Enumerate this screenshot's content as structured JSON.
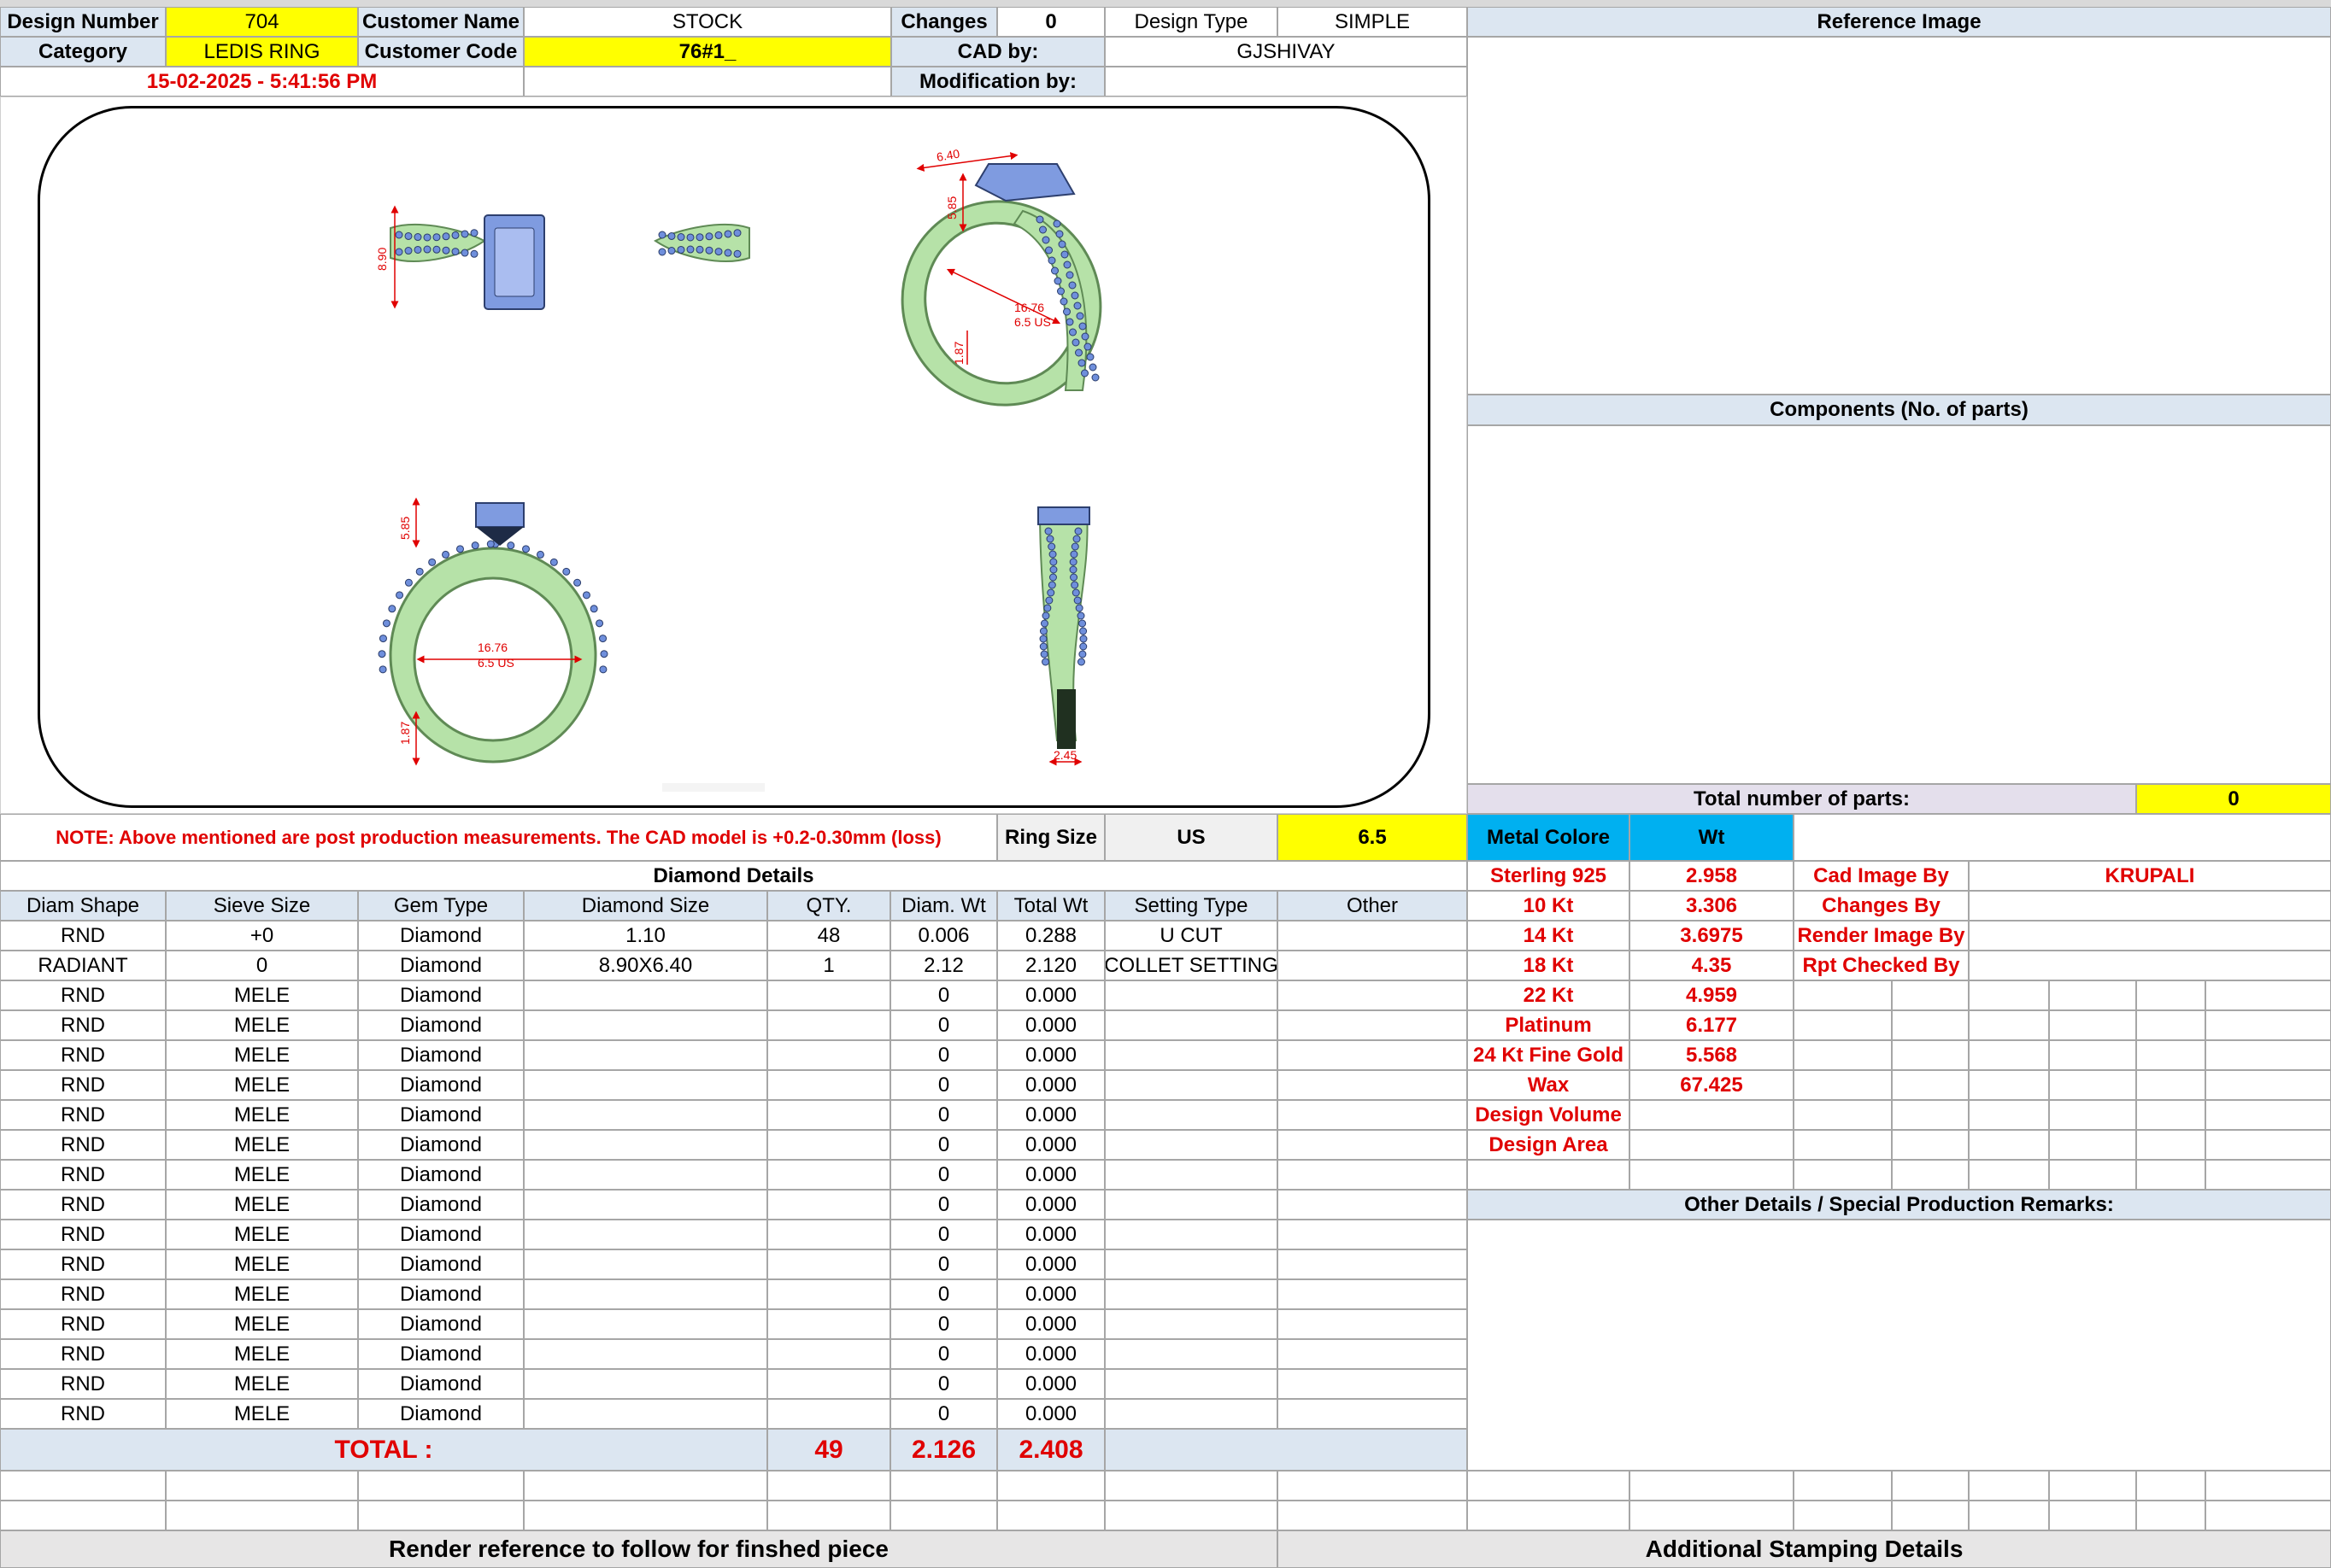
{
  "header": {
    "design_number_label": "Design Number",
    "design_number": "704",
    "customer_name_label": "Customer Name",
    "customer_name": "STOCK",
    "changes_label": "Changes",
    "changes": "0",
    "design_type_label": "Design Type",
    "design_type": "SIMPLE",
    "reference_image_label": "Reference Image",
    "category_label": "Category",
    "category": "LEDIS RING",
    "customer_code_label": "Customer Code",
    "customer_code": "76#1_",
    "cad_by_label": "CAD by:",
    "cad_by": "GJSHIVAY",
    "timestamp": "15-02-2025 - 5:41:56 PM",
    "modification_by_label": "Modification by:"
  },
  "drawing": {
    "top_width": "8.90",
    "persp_w": "6.40",
    "persp_h": "5.85",
    "persp_size": "16.76",
    "persp_us": "6.5 US",
    "persp_shank": "1.87",
    "front_h": "5.85",
    "front_size": "16.76",
    "front_us": "6.5 US",
    "front_shank": "1.87",
    "side_w": "2.45",
    "metal_color": "#b6e2a8",
    "metal_dark": "#5f8a55",
    "stone_color": "#7f9be0",
    "dimension_color": "#e00000"
  },
  "components": {
    "label": "Components (No. of parts)",
    "total_parts_label": "Total number of parts:",
    "total_parts": "0"
  },
  "note": {
    "text": "NOTE: Above mentioned are post production measurements. The CAD model is +0.2-0.30mm (loss)",
    "ring_size_label": "Ring Size",
    "ring_size_unit": "US",
    "ring_size": "6.5"
  },
  "metal": {
    "color_label": "Metal Colore",
    "wt_label": "Wt",
    "rows": [
      {
        "name": "Sterling 925",
        "wt": "2.958"
      },
      {
        "name": "10 Kt",
        "wt": "3.306"
      },
      {
        "name": "14 Kt",
        "wt": "3.6975"
      },
      {
        "name": "18 Kt",
        "wt": "4.35"
      },
      {
        "name": "22 Kt",
        "wt": "4.959"
      },
      {
        "name": "Platinum",
        "wt": "6.177"
      },
      {
        "name": "24 Kt Fine Gold",
        "wt": "5.568"
      },
      {
        "name": "Wax",
        "wt": "67.425"
      },
      {
        "name": "Design Volume",
        "wt": ""
      },
      {
        "name": "Design Area",
        "wt": ""
      }
    ]
  },
  "credits": {
    "rows": [
      {
        "label": "Cad Image By",
        "value": "KRUPALI"
      },
      {
        "label": "Changes By",
        "value": ""
      },
      {
        "label": "Render Image By",
        "value": ""
      },
      {
        "label": "Rpt Checked By",
        "value": ""
      }
    ]
  },
  "remarks_label": "Other Details / Special Production Remarks:",
  "diamond": {
    "title": "Diamond Details",
    "headers": [
      "Diam Shape",
      "Sieve Size",
      "Gem Type",
      "Diamond Size",
      "QTY.",
      "Diam. Wt",
      "Total Wt",
      "Setting Type",
      "Other"
    ],
    "rows": [
      [
        "RND",
        "+0",
        "Diamond",
        "1.10",
        "48",
        "0.006",
        "0.288",
        "U CUT",
        ""
      ],
      [
        "RADIANT",
        "0",
        "Diamond",
        "8.90X6.40",
        "1",
        "2.12",
        "2.120",
        "COLLET SETTING",
        ""
      ],
      [
        "RND",
        "MELE",
        "Diamond",
        "",
        "",
        "0",
        "0.000",
        "",
        ""
      ],
      [
        "RND",
        "MELE",
        "Diamond",
        "",
        "",
        "0",
        "0.000",
        "",
        ""
      ],
      [
        "RND",
        "MELE",
        "Diamond",
        "",
        "",
        "0",
        "0.000",
        "",
        ""
      ],
      [
        "RND",
        "MELE",
        "Diamond",
        "",
        "",
        "0",
        "0.000",
        "",
        ""
      ],
      [
        "RND",
        "MELE",
        "Diamond",
        "",
        "",
        "0",
        "0.000",
        "",
        ""
      ],
      [
        "RND",
        "MELE",
        "Diamond",
        "",
        "",
        "0",
        "0.000",
        "",
        ""
      ],
      [
        "RND",
        "MELE",
        "Diamond",
        "",
        "",
        "0",
        "0.000",
        "",
        ""
      ],
      [
        "RND",
        "MELE",
        "Diamond",
        "",
        "",
        "0",
        "0.000",
        "",
        ""
      ],
      [
        "RND",
        "MELE",
        "Diamond",
        "",
        "",
        "0",
        "0.000",
        "",
        ""
      ],
      [
        "RND",
        "MELE",
        "Diamond",
        "",
        "",
        "0",
        "0.000",
        "",
        ""
      ],
      [
        "RND",
        "MELE",
        "Diamond",
        "",
        "",
        "0",
        "0.000",
        "",
        ""
      ],
      [
        "RND",
        "MELE",
        "Diamond",
        "",
        "",
        "0",
        "0.000",
        "",
        ""
      ],
      [
        "RND",
        "MELE",
        "Diamond",
        "",
        "",
        "0",
        "0.000",
        "",
        ""
      ],
      [
        "RND",
        "MELE",
        "Diamond",
        "",
        "",
        "0",
        "0.000",
        "",
        ""
      ],
      [
        "RND",
        "MELE",
        "Diamond",
        "",
        "",
        "0",
        "0.000",
        "",
        ""
      ]
    ],
    "total_label": "TOTAL :",
    "total_qty": "49",
    "total_diam_wt": "2.126",
    "total_wt": "2.408"
  },
  "footer": {
    "render_ref": "Render reference to follow for finshed piece",
    "stamping": "Additional Stamping Details"
  }
}
